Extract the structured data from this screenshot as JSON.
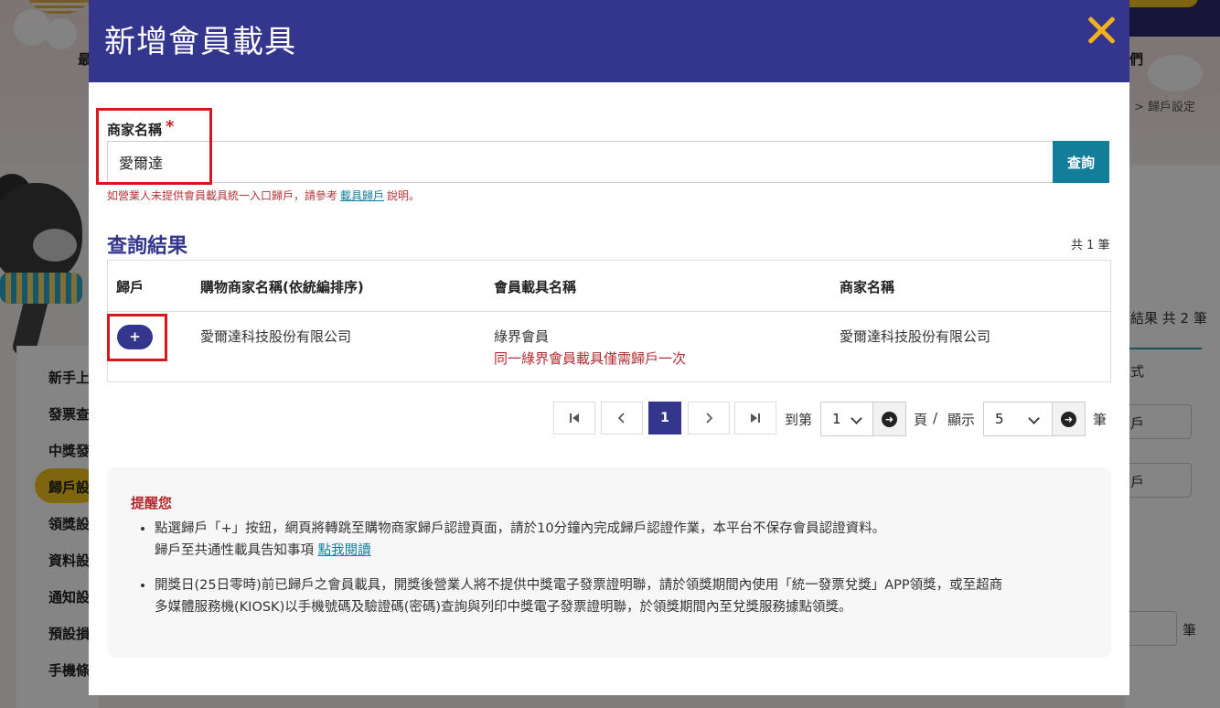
{
  "modal": {
    "title": "新增會員載具",
    "close_icon": "close-icon"
  },
  "form": {
    "label": "商家名稱",
    "required_mark": "*",
    "value": "愛爾達",
    "search_label": "查詢",
    "hint_prefix": "如營業人未提供會員載具統一入口歸戶，請參考",
    "hint_link": "載具歸戶",
    "hint_suffix": "說明。"
  },
  "results": {
    "title": "查詢結果",
    "total": "共 1 筆",
    "columns": [
      "歸戶",
      "購物商家名稱(依統編排序)",
      "會員載具名稱",
      "商家名稱"
    ],
    "rows": [
      {
        "add_label": "+",
        "merchant": "愛爾達科技股份有限公司",
        "carrier_name": "綠界會員",
        "carrier_note": "同一綠界會員載具僅需歸戶一次",
        "store_name": "愛爾達科技股份有限公司"
      }
    ]
  },
  "pagination": {
    "first_icon": "first-page-icon",
    "prev_icon": "prev-page-icon",
    "current": "1",
    "next_icon": "next-page-icon",
    "last_icon": "last-page-icon",
    "goto_label": "到第",
    "page_value": "1",
    "page_label": "頁",
    "separator": "/",
    "show_label": "顯示",
    "size_value": "5",
    "unit_label": "筆"
  },
  "reminder": {
    "title": "提醒您",
    "item1_text": "點選歸戶「+」按鈕，網頁將轉跳至購物商家歸戶認證頁面，請於10分鐘內完成歸戶認證作業，本平台不保存會員認證資料。",
    "item1_sub_prefix": "歸戶至共通性載具告知事項",
    "item1_link": "點我閱讀",
    "item2_line1": "開獎日(25日零時)前已歸戶之會員載具，開獎後營業人將不提供中獎電子發票證明聯，請於領獎期間內使用「統一發票兌獎」APP領獎，或至超商",
    "item2_line2": "多媒體服務機(KIOSK)以手機號碼及驗證碼(密碼)查詢與列印中獎電子發票證明聯，於領獎期間內至兌獎服務據點領獎。"
  },
  "background": {
    "nav_left": "最",
    "nav_right": "們",
    "breadcrumb": "> 歸戶設定",
    "sidebar": [
      "新手上",
      "發票查",
      "中獎發",
      "歸戶設",
      "領獎設",
      "資料設",
      "通知設",
      "預設損",
      "手機條"
    ],
    "right_result": "結果 共 2 筆",
    "right_sort": "式",
    "right_select": "戶",
    "right_unit": "筆"
  },
  "colors": {
    "brand": "#33368c",
    "teal": "#127e9a",
    "highlight_red": "#d8161c",
    "close_yellow": "#f1b21b"
  }
}
